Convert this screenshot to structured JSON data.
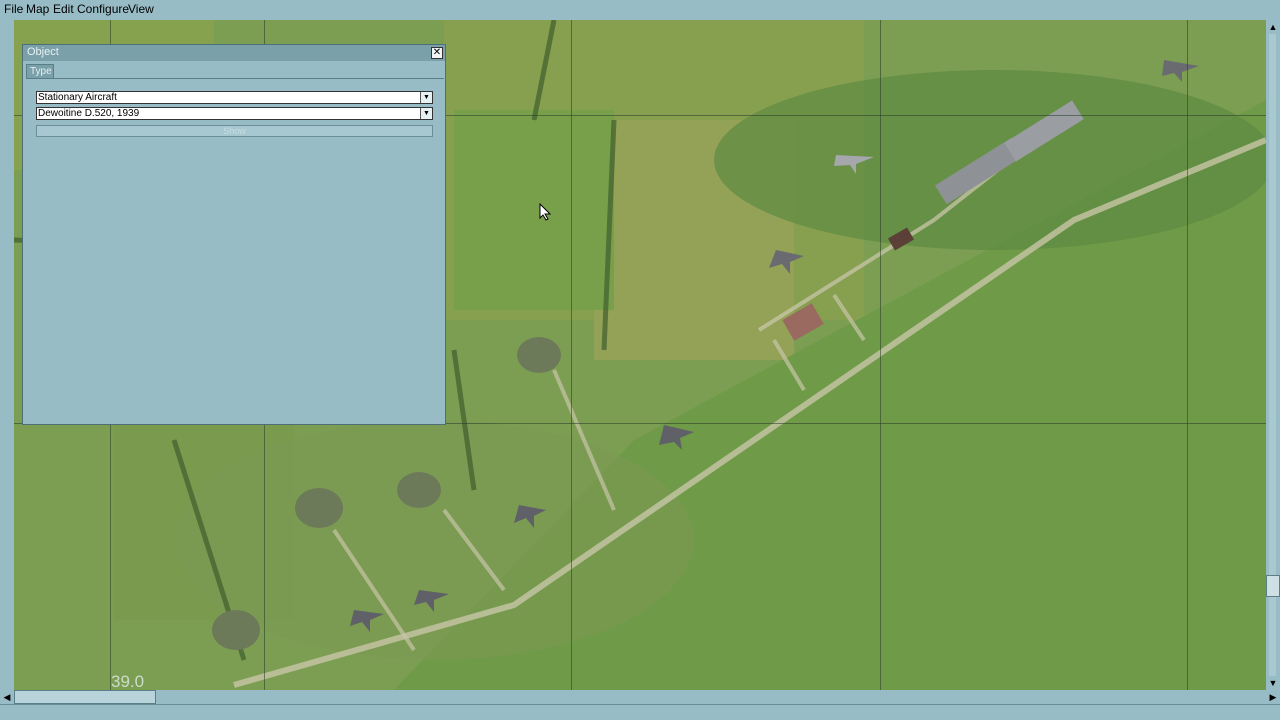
{
  "menu": {
    "items": [
      "File",
      "Map",
      "Edit",
      "Configure",
      "View"
    ]
  },
  "map": {
    "coordinate_label": "39.0"
  },
  "object_panel": {
    "title": "Object",
    "tab_label": "Type",
    "category_select": "Stationary Aircraft",
    "model_select": "Dewoitine D.520, 1939",
    "show_button": "Show"
  },
  "icons": {
    "close": "close-icon",
    "dropdown": "chevron-down-icon",
    "cursor": "mouse-pointer-icon"
  },
  "colors": {
    "ui_background": "#97bcc6",
    "title_bar": "#7aa0aa",
    "map_grass": "#7ea055"
  }
}
